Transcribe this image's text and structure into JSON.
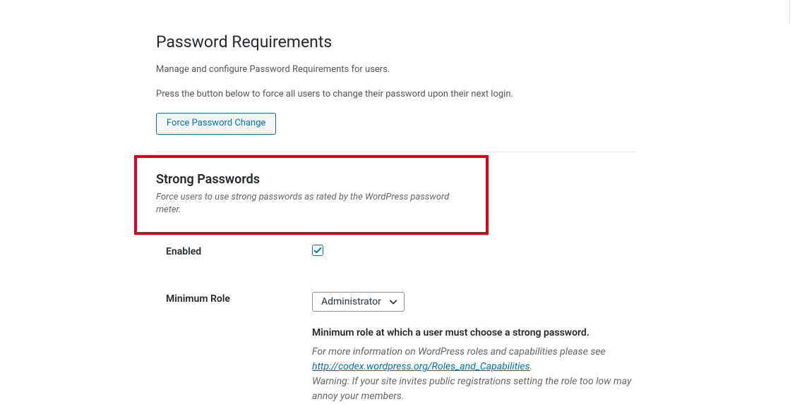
{
  "header": {
    "title": "Password Requirements",
    "intro1": "Manage and configure Password Requirements for users.",
    "intro2": "Press the button below to force all users to change their password upon their next login.",
    "forceButton": "Force Password Change"
  },
  "strongPasswords": {
    "title": "Strong Passwords",
    "description": "Force users to use strong passwords as rated by the WordPress password meter."
  },
  "fields": {
    "enabled": {
      "label": "Enabled",
      "checked": true
    },
    "minimumRole": {
      "label": "Minimum Role",
      "selected": "Administrator",
      "helpBold": "Minimum role at which a user must choose a strong password.",
      "helpText1": "For more information on WordPress roles and capabilities please see ",
      "helpLink": "http://codex.wordpress.org/Roles_and_Capabilities",
      "helpText2": ".",
      "helpWarning": "Warning: If your site invites public registrations setting the role too low may annoy your members."
    }
  }
}
